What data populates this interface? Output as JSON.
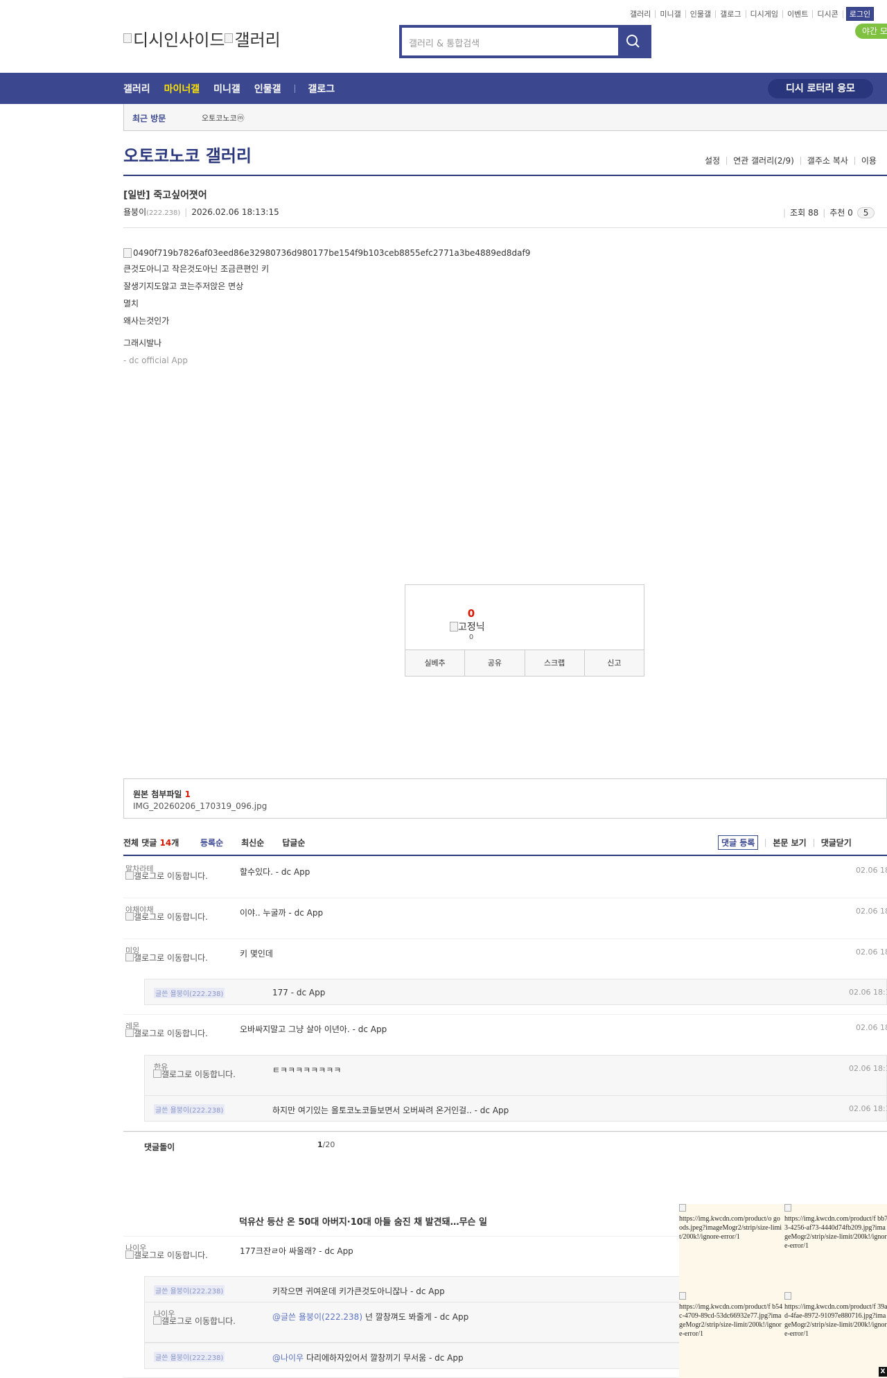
{
  "header": {
    "top_links": [
      "갤러리",
      "미니갤",
      "인물갤",
      "갤로그",
      "디시게임",
      "이벤트",
      "디시콘"
    ],
    "login_label": "로그인",
    "night_mode_label": "야간 모",
    "logo_alt_1": "디시인사이드",
    "logo_alt_2": "갤러리",
    "search_placeholder": "갤러리 & 통합검색"
  },
  "gnb": {
    "items": [
      "갤러리",
      "마이너갤",
      "미니갤",
      "인물갤",
      "갤로그"
    ],
    "active_index": 1,
    "lotto_label": "디시 로터리 응모",
    "accent_color": "#3b4890",
    "active_color": "#ffe300"
  },
  "recent_visit": {
    "label": "최근 방문",
    "item": "오토코노코ⓜ"
  },
  "gallery": {
    "title": "오토코노코 갤러리",
    "options": [
      "설정",
      "연관 갤러리(2/9)",
      "갤주소 복사",
      "이용"
    ]
  },
  "post": {
    "title": "[일반] 죽고싶어졋어",
    "author": "욜붕이",
    "author_ip": "(222.238)",
    "datetime": "2026.02.06 18:13:15",
    "views_label": "조회 88",
    "recommend_label": "추천 0",
    "pill_label": "5",
    "image_alt": "0490f719b7826af03eed86e32980736d980177be154f9b103ceb8855efc2771a3be4889ed8daf9",
    "lines": [
      "큰것도아니고 작은것도아닌 조금큰편인 키",
      "잘생기지도않고 코는주저앉은 면상",
      "멸치",
      "왜사는것인가"
    ],
    "line_after_gap": "그래시발나",
    "app_sign": "- dc official App"
  },
  "recommend": {
    "count": "0",
    "fix_alt": "고정닉",
    "fix_count": "0",
    "buttons": [
      "실베추",
      "공유",
      "스크랩",
      "신고"
    ]
  },
  "attachment": {
    "label": "원본 첨부파일",
    "count": "1",
    "filename": "IMG_20260206_170319_096.jpg"
  },
  "comments_header": {
    "total_label": "전체 댓글",
    "total_count": "14",
    "total_unit": "개",
    "sort_options": [
      "등록순",
      "최신순",
      "답글순"
    ],
    "register_label": "댓글 등록",
    "view_body_label": "본문 보기",
    "close_label": "댓글닫기"
  },
  "galcon_alt": "갤로그로 이동합니다.",
  "comments": [
    {
      "nick": "말차라테",
      "text": "할수있다. - dc App",
      "date": "02.06 18"
    },
    {
      "nick": "야채야채",
      "text": "이야.. 누굴까 - dc App",
      "date": "02.06 18"
    },
    {
      "nick": "미잉",
      "text": "키 몇인데",
      "date": "02.06 18"
    },
    {
      "nick": "레몬",
      "text": "오바싸지말고 그냥 살아 이년아. - dc App",
      "date": "02.06 18"
    },
    {
      "nick": "나이우",
      "text": "177크잔ㄹ아 싸울래? - dc App",
      "date": ""
    }
  ],
  "replies": [
    {
      "writer": "글쓴 욜붕이(222.238)",
      "text": "177 - dc App",
      "date": "02.06 18:1"
    },
    {
      "nick": "한유",
      "text": "ㅌㅋㅋㅋㅋㅋㅋㅋㅋ",
      "date": "02.06 18:1"
    },
    {
      "writer": "글쓴 욜붕이(222.238)",
      "text": "하지만 여기있는 올토코노코들보면서 오버싸려 온거인걸.. - dc App",
      "date": "02.06 18:1"
    },
    {
      "writer": "글쓴 욜붕이(222.238)",
      "text": "키작으면 귀여운데 키가큰것도아니잖나 - dc App",
      "date": ""
    },
    {
      "nick": "나이우",
      "mention": "@글쓴 욜붕이(222.238)",
      "text": " 넌 깔창껴도 봐줄게 - dc App",
      "date": ""
    },
    {
      "writer": "글쓴 욜붕이(222.238)",
      "mention": "@나이우",
      "text": " 다리에하자있어서 깔창끼기 무서움 - dc App",
      "date": ""
    }
  ],
  "comment_footer": {
    "label": "댓글돌이",
    "page": "1",
    "total": "/20"
  },
  "news_title": "덕유산 등산 온 50대 아버지·10대 아들 숨진 채 발견돼…무슨 일",
  "ads": [
    "https://img.kwcdn.com/product/o goods.jpeg?imageMogr2/strip/size-limit/200k!/ignore-error/1",
    "https://img.kwcdn.com/product/f bb73-4256-af73-4440d74fb209.jpg?imageMogr2/strip/size-limit/200k!/ignore-error/1",
    "https://img.kwcdn.com/product/f b54c-4709-89cd-53dc66932e77.jpg?imageMogr2/strip/size-limit/200k!/ignore-error/1",
    "https://img.kwcdn.com/product/f 39ad-4fae-8972-91097e880716.jpg?imageMogr2/strip/size-limit/200k!/ignore-error/1"
  ],
  "ad_close": "X"
}
